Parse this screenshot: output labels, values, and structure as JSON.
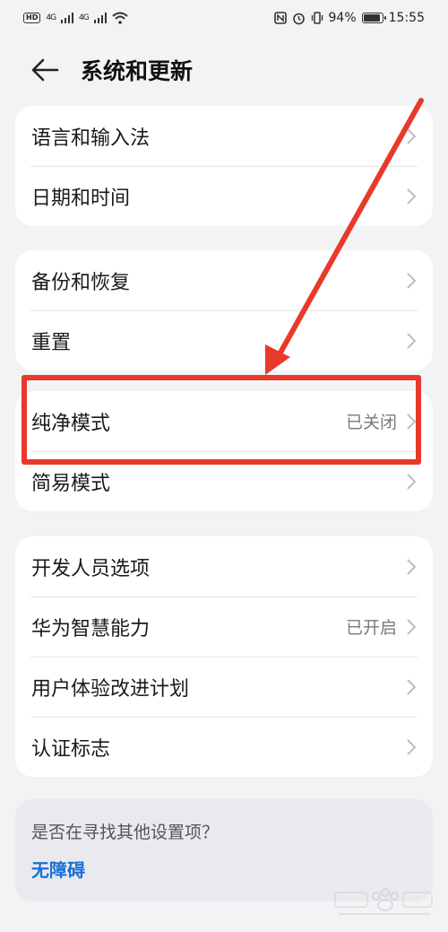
{
  "status_bar": {
    "left_badge": "HD",
    "sig1": "4G",
    "sig2": "4G",
    "battery_percent": "94%",
    "battery_level": 0.94,
    "time": "15:55"
  },
  "header": {
    "title": "系统和更新",
    "back_icon": "arrow-left-icon"
  },
  "groups": [
    {
      "items": [
        {
          "label": "语言和输入法"
        },
        {
          "label": "日期和时间"
        }
      ]
    },
    {
      "items": [
        {
          "label": "备份和恢复"
        },
        {
          "label": "重置"
        }
      ]
    },
    {
      "items": [
        {
          "label": "纯净模式",
          "value": "已关闭"
        },
        {
          "label": "简易模式"
        }
      ]
    },
    {
      "items": [
        {
          "label": "开发人员选项"
        },
        {
          "label": "华为智慧能力",
          "value": "已开启"
        },
        {
          "label": "用户体验改进计划"
        },
        {
          "label": "认证标志"
        }
      ]
    }
  ],
  "suggestion": {
    "question": "是否在寻找其他设置项？",
    "link": "无障碍"
  },
  "colors": {
    "background": "#f1f3f5",
    "card": "#ffffff",
    "link": "#1a6fd8",
    "annotation": "#e8392b"
  }
}
